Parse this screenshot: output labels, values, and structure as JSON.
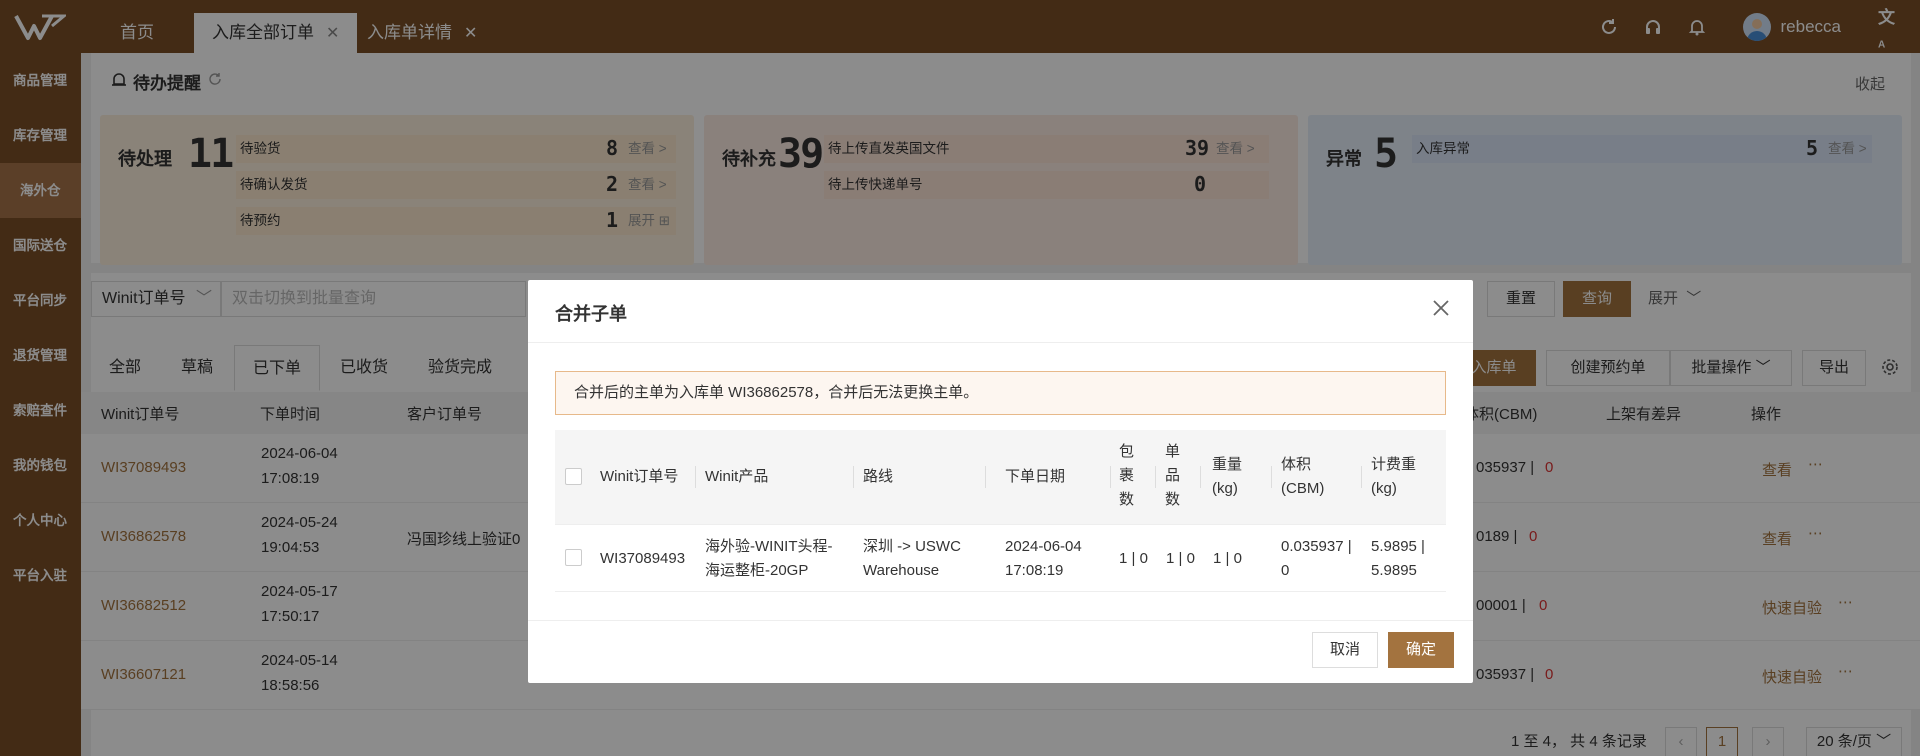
{
  "topbar": {
    "tabs": [
      {
        "label": "首页",
        "active": false,
        "closable": false
      },
      {
        "label": "入库全部订单",
        "active": true,
        "closable": true
      },
      {
        "label": "入库单详情",
        "active": false,
        "closable": true
      }
    ],
    "username": "rebecca",
    "icons": [
      "refresh-icon",
      "headset-icon",
      "bell-icon",
      "user-avatar",
      "translate-icon"
    ],
    "brand_color": "#7a4f27"
  },
  "sidebar": {
    "items": [
      {
        "label": "商品管理",
        "active": false
      },
      {
        "label": "库存管理",
        "active": false
      },
      {
        "label": "海外仓",
        "active": true
      },
      {
        "label": "国际送仓",
        "active": false
      },
      {
        "label": "平台同步",
        "active": false
      },
      {
        "label": "退货管理",
        "active": false
      },
      {
        "label": "索赔查件",
        "active": false
      },
      {
        "label": "我的钱包",
        "active": false
      },
      {
        "label": "个人中心",
        "active": false
      },
      {
        "label": "平台入驻",
        "active": false
      }
    ]
  },
  "todo": {
    "title": "待办提醒",
    "collapse_label": "收起",
    "panels": [
      {
        "title": "待处理",
        "count": "11",
        "rows": [
          {
            "label": "待验货",
            "count": "8",
            "link": "查看 >"
          },
          {
            "label": "待确认发货",
            "count": "2",
            "link": "查看 >"
          },
          {
            "label": "待预约",
            "count": "1",
            "link": "展开 ⊞"
          }
        ]
      },
      {
        "title": "待补充",
        "count": "39",
        "rows": [
          {
            "label": "待上传直发英国文件",
            "count": "39",
            "link": "查看 >"
          },
          {
            "label": "待上传快递单号",
            "count": "0",
            "link": ""
          }
        ]
      },
      {
        "title": "异常",
        "count": "5",
        "rows": [
          {
            "label": "入库异常",
            "count": "5",
            "link": "查看 >"
          }
        ]
      }
    ]
  },
  "filters": {
    "order_type": "Winit订单号",
    "search_placeholder": "双击切换到批量查询",
    "reset": "重置",
    "query": "查询",
    "expand": "展开"
  },
  "status_tabs": [
    "全部",
    "草稿",
    "已下单",
    "已收货",
    "验货完成"
  ],
  "active_status_tab": "已下单",
  "actions": {
    "inbound": "入库单",
    "create_booking": "创建预约单",
    "batch": "批量操作",
    "export": "导出"
  },
  "table": {
    "headers": [
      "Winit订单号",
      "下单时间",
      "客户订单号",
      "体积(CBM)",
      "上架有差异",
      "操作"
    ],
    "rows": [
      {
        "order": "WI37089493",
        "date": "2024-06-04",
        "time": "17:08:19",
        "customer": "",
        "volume": "035937 |",
        "diff": "0",
        "action": "查看"
      },
      {
        "order": "WI36862578",
        "date": "2024-05-24",
        "time": "19:04:53",
        "customer": "冯国珍线上验证0",
        "volume": "0189 |",
        "diff": "0",
        "action": "查看"
      },
      {
        "order": "WI36682512",
        "date": "2024-05-17",
        "time": "17:50:17",
        "customer": "",
        "volume": "00001 |",
        "diff": "0",
        "action": "快速自验"
      },
      {
        "order": "WI36607121",
        "date": "2024-05-14",
        "time": "18:58:56",
        "customer": "",
        "volume": "035937 |",
        "diff": "0",
        "action": "快速自验"
      }
    ]
  },
  "pagination": {
    "summary": "1 至 4， 共 4 条记录",
    "current": "1",
    "page_size": "20 条/页"
  },
  "modal": {
    "title": "合并子单",
    "notice": "合并后的主单为入库单 WI36862578，合并后无法更换主单。",
    "headers": [
      "Winit订单号",
      "Winit产品",
      "路线",
      "下单日期",
      "包裹数",
      "单品数",
      "重量 (kg)",
      "体积 (CBM)",
      "计费重 (kg)"
    ],
    "header_lines": [
      [
        "Winit订单号"
      ],
      [
        "Winit产品"
      ],
      [
        "路线"
      ],
      [
        "下单日期"
      ],
      [
        "包",
        "裹",
        "数"
      ],
      [
        "单",
        "品",
        "数"
      ],
      [
        "重量",
        "(kg)"
      ],
      [
        "体积",
        "(CBM)"
      ],
      [
        "计费重",
        "(kg)"
      ]
    ],
    "rows": [
      {
        "order": "WI37089493",
        "product": [
          "海外验-WINIT头程-",
          "海运整柜-20GP"
        ],
        "route": [
          "深圳 -> USWC",
          "Warehouse"
        ],
        "date": [
          "2024-06-04",
          "17:08:19"
        ],
        "packages": "1 | 0",
        "items": "1 | 0",
        "weight": "1 | 0",
        "volume": [
          "0.035937 |",
          "0"
        ],
        "charge_weight": [
          "5.9895 |",
          "5.9895"
        ]
      }
    ],
    "cancel": "取消",
    "confirm": "确定",
    "accent_color": "#a3733f"
  }
}
